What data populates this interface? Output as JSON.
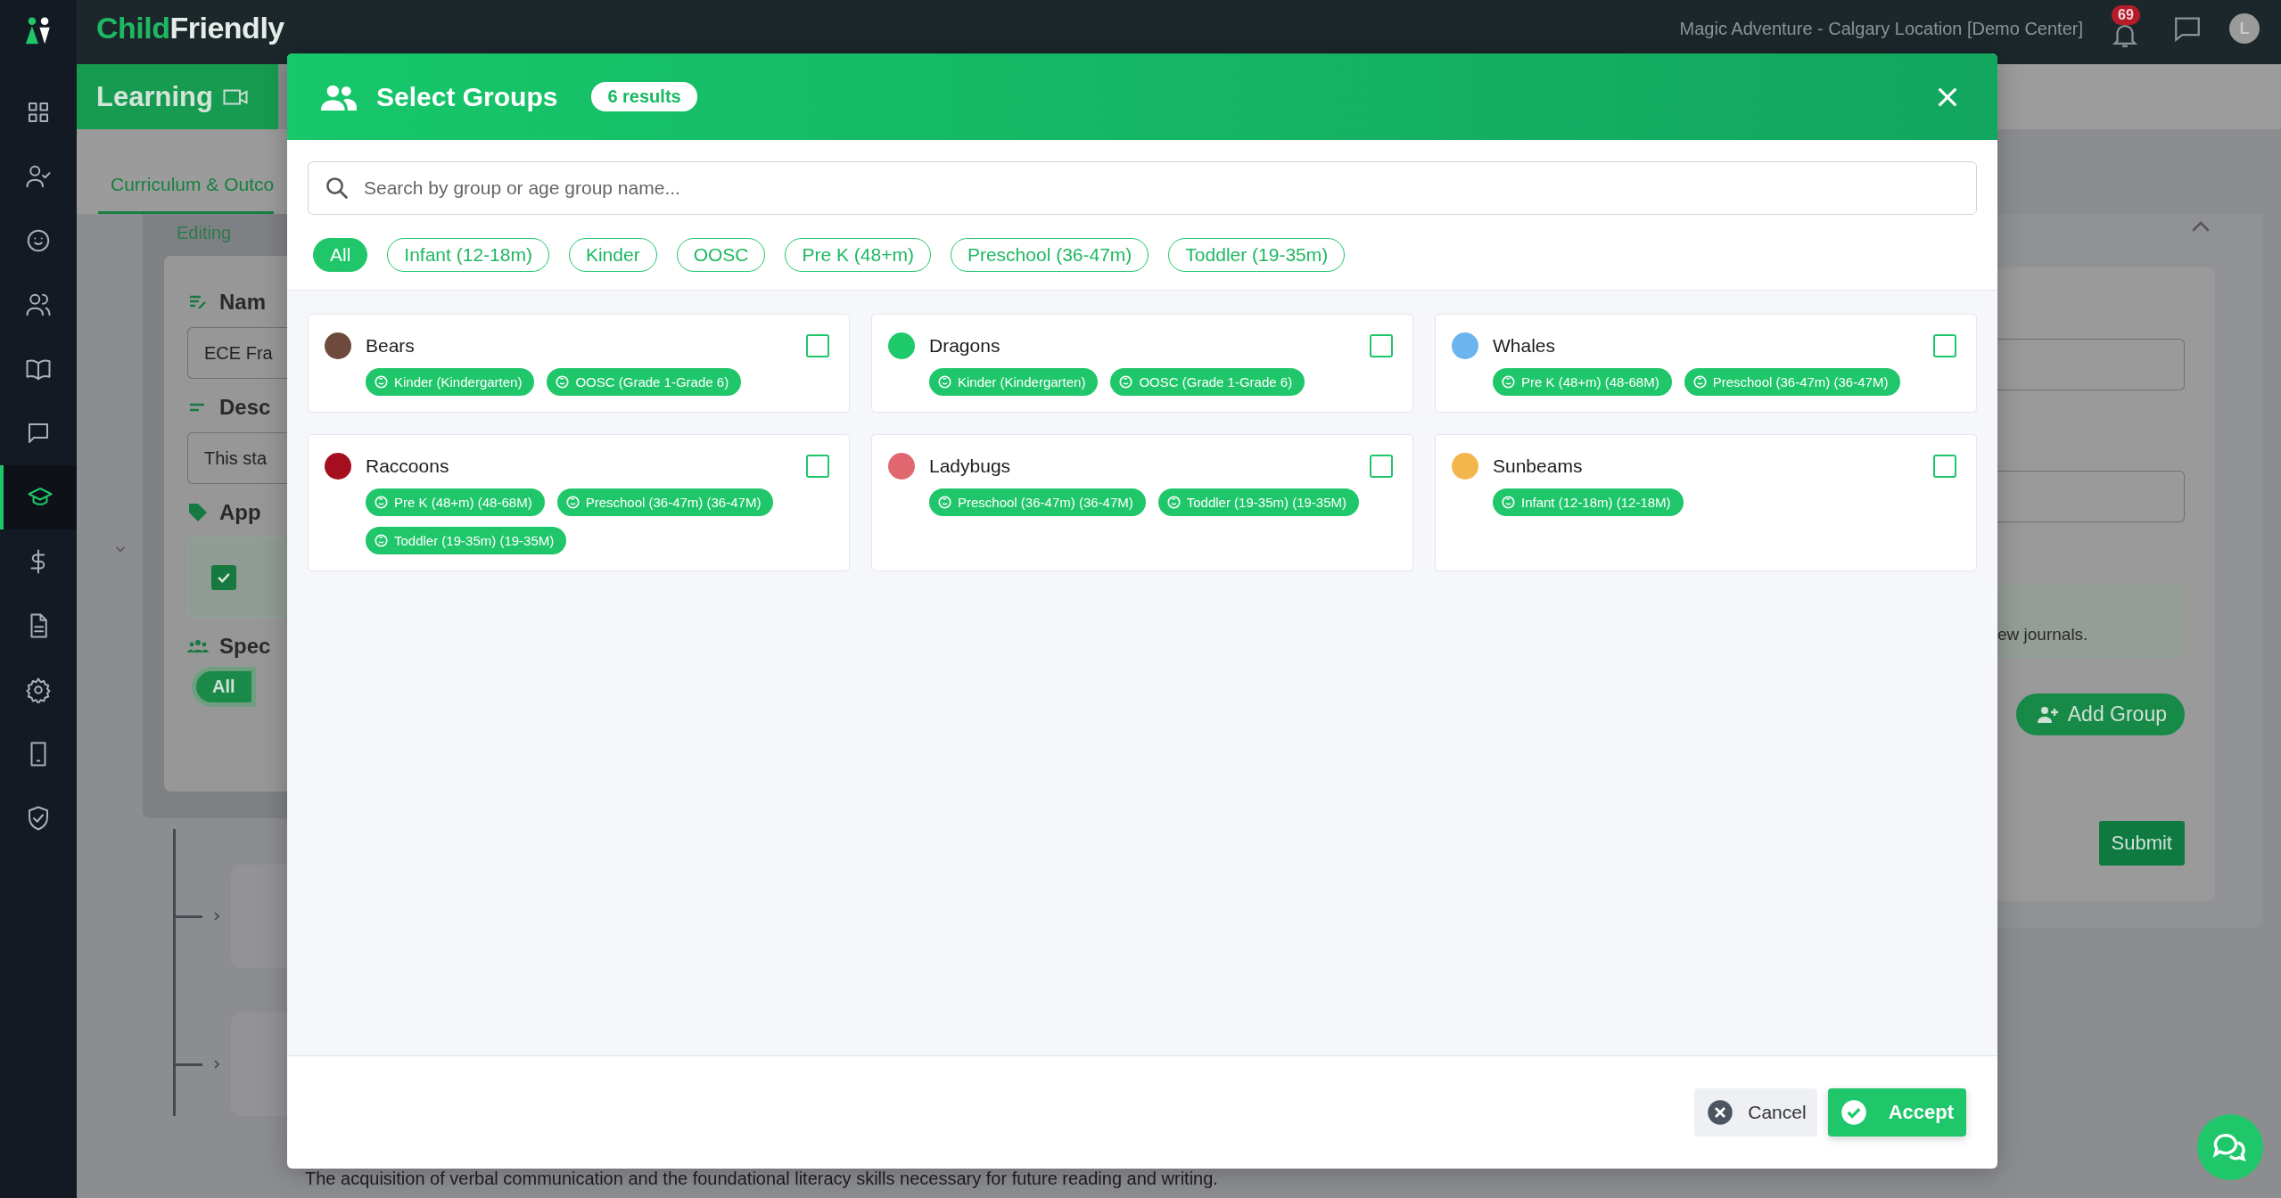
{
  "sidebar": {
    "items": [
      {
        "selected": false
      },
      {
        "selected": false
      },
      {
        "selected": false
      },
      {
        "selected": false
      },
      {
        "selected": false
      },
      {
        "selected": false
      },
      {
        "selected": true
      },
      {
        "selected": false
      },
      {
        "selected": false
      },
      {
        "selected": false
      },
      {
        "selected": false
      },
      {
        "selected": false
      }
    ]
  },
  "header": {
    "logo_first": "Child",
    "logo_second": "Friendly",
    "location": "Magic Adventure - Calgary Location [Demo Center]",
    "notifications": "69",
    "avatar": "L"
  },
  "background": {
    "section_title": "Learning",
    "tab": "Curriculum & Outco",
    "editing": "Editing",
    "name_label": "Nam",
    "name_value": "ECE Fra",
    "description_label": "Desc",
    "description_value": "This sta",
    "applies_label": "App",
    "applies_checked": true,
    "specific_label": "Spec",
    "group_pill": "All",
    "note": "ew journals.",
    "add_group": "Add Group",
    "submit": "Submit",
    "footer_text": "The acquisition of verbal communication and the foundational literacy skills necessary for future reading and writing."
  },
  "modal": {
    "title": "Select Groups",
    "count": "6 results",
    "search": {
      "placeholder": "Search by group or age group name..."
    },
    "filters": [
      {
        "label": "All",
        "selected": true
      },
      {
        "label": "Infant (12-18m)",
        "selected": false
      },
      {
        "label": "Kinder",
        "selected": false
      },
      {
        "label": "OOSC",
        "selected": false
      },
      {
        "label": "Pre K (48+m)",
        "selected": false
      },
      {
        "label": "Preschool (36-47m)",
        "selected": false
      },
      {
        "label": "Toddler (19-35m)",
        "selected": false
      }
    ],
    "groups": [
      {
        "name": "Bears",
        "color": "#6e4a3c",
        "checked": false,
        "tags": [
          "Kinder (Kindergarten)",
          "OOSC (Grade 1-Grade 6)"
        ]
      },
      {
        "name": "Dragons",
        "color": "#1ec96b",
        "checked": false,
        "tags": [
          "Kinder (Kindergarten)",
          "OOSC (Grade 1-Grade 6)"
        ]
      },
      {
        "name": "Whales",
        "color": "#6ab4f0",
        "checked": false,
        "tags": [
          "Pre K (48+m) (48-68M)",
          "Preschool (36-47m) (36-47M)"
        ]
      },
      {
        "name": "Raccoons",
        "color": "#a50e1f",
        "checked": false,
        "tags": [
          "Pre K (48+m) (48-68M)",
          "Preschool (36-47m) (36-47M)",
          "Toddler (19-35m) (19-35M)"
        ]
      },
      {
        "name": "Ladybugs",
        "color": "#e06670",
        "checked": false,
        "tags": [
          "Preschool (36-47m) (36-47M)",
          "Toddler (19-35m) (19-35M)"
        ]
      },
      {
        "name": "Sunbeams",
        "color": "#f5b54d",
        "checked": false,
        "tags": [
          "Infant (12-18m) (12-18M)"
        ]
      }
    ],
    "buttons": {
      "cancel": "Cancel",
      "accept": "Accept"
    }
  }
}
